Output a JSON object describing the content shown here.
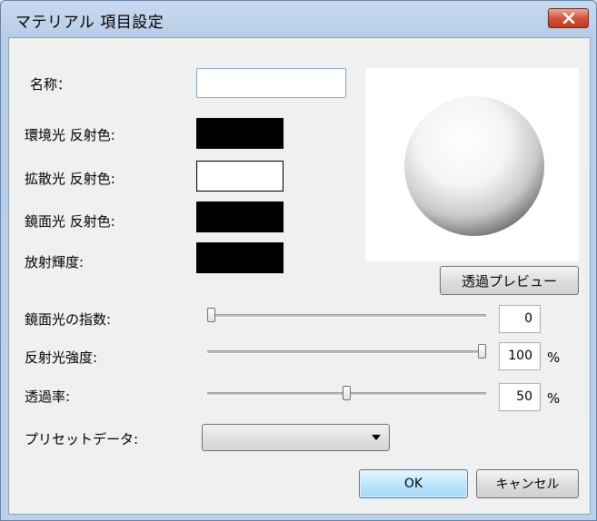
{
  "window": {
    "title": "マテリアル 項目設定"
  },
  "labels": {
    "name": "名称：",
    "ambient": "環境光 反射色:",
    "diffuse": "拡散光 反射色:",
    "specular": "鏡面光 反射色:",
    "emissive": "放射輝度:",
    "specular_exponent": "鏡面光の指数:",
    "reflect_intensity": "反射光強度:",
    "transparency": "透過率:",
    "preset": "プリセットデータ:"
  },
  "fields": {
    "name_value": ""
  },
  "colors": {
    "ambient": "#000000",
    "diffuse": "#ffffff",
    "specular": "#000000",
    "emissive": "#000000"
  },
  "sliders": {
    "specular_exponent": {
      "value": "0",
      "fraction": 0.0
    },
    "reflect_intensity": {
      "value": "100",
      "unit": "%",
      "fraction": 1.0
    },
    "transparency": {
      "value": "50",
      "unit": "%",
      "fraction": 0.5
    }
  },
  "preset": {
    "selected": ""
  },
  "buttons": {
    "preview_transparency": "透過プレビュー",
    "ok": "OK",
    "cancel": "キャンセル"
  }
}
